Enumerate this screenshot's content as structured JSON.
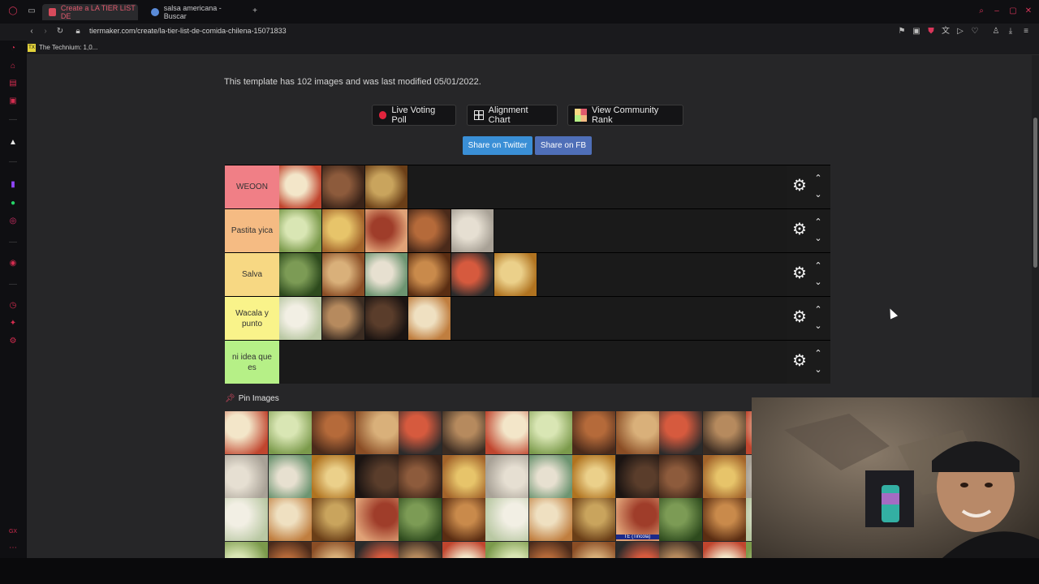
{
  "tabs": [
    {
      "label": "Create a LA TIER LIST DE",
      "active": true
    },
    {
      "label": "salsa americana - Buscar",
      "active": false
    }
  ],
  "new_tab_label": "+",
  "url": "tiermaker.com/create/la-tier-list-de-comida-chilena-15071833",
  "bookmark": {
    "badge": "TX",
    "label": "The Technium: 1,0..."
  },
  "template_info": "This template has 102 images and was last modified 05/01/2022.",
  "buttons": {
    "live_voting": "Live Voting Poll",
    "alignment": "Alignment Chart",
    "community": "View Community Rank",
    "share_twitter": "Share on Twitter",
    "share_fb": "Share on FB"
  },
  "colors": {
    "accent": "#d32c4f",
    "twitter": "#3a8fd6",
    "fb": "#4f6fb8"
  },
  "tiers": [
    {
      "label": "WEOON",
      "color": "#f07f86",
      "items": 3
    },
    {
      "label": "Pastita yica",
      "color": "#f5bb83",
      "items": 5
    },
    {
      "label": "Salva",
      "color": "#f7d883",
      "items": 6
    },
    {
      "label": "Wacala y punto",
      "color": "#f9f38a",
      "items": 4
    },
    {
      "label": "ni idea que es",
      "color": "#b6f087",
      "items": 0
    }
  ],
  "icons": {
    "gear": "gear-icon",
    "up": "chevron-up-icon",
    "down": "chevron-down-icon",
    "pin": "pin-icon"
  },
  "pin_images_label": "Pin Images",
  "pool_label_text": "TE (Tincola)"
}
